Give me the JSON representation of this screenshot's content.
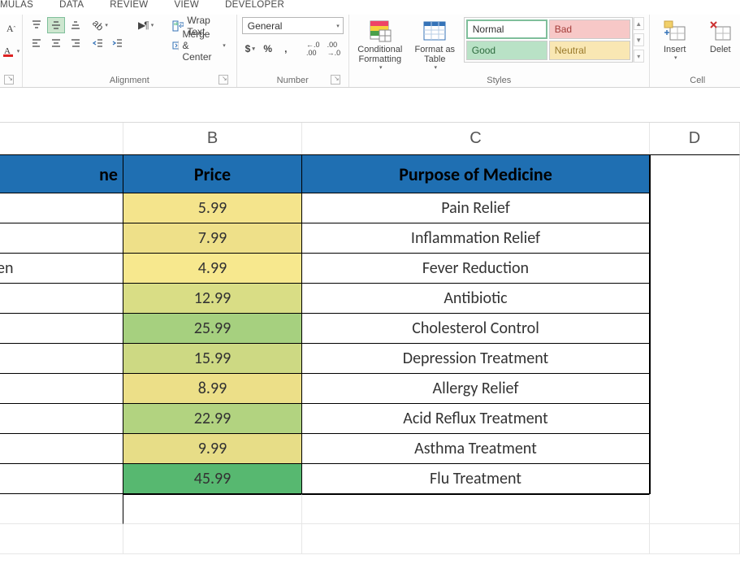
{
  "tabs": {
    "formulas": "MULAS",
    "data": "DATA",
    "review": "REVIEW",
    "view": "VIEW",
    "developer": "DEVELOPER"
  },
  "ribbon": {
    "font": {
      "group_label": ""
    },
    "alignment": {
      "group_label": "Alignment",
      "wrap_label": "Wrap Text",
      "merge_label": "Merge & Center"
    },
    "number": {
      "group_label": "Number",
      "format_selected": "General"
    },
    "styles": {
      "group_label": "Styles",
      "cond_format_label": "Conditional\nFormatting",
      "table_label": "Format as\nTable",
      "normal": "Normal",
      "bad": "Bad",
      "good": "Good",
      "neutral": "Neutral"
    },
    "cells": {
      "group_label": "Cell",
      "insert_label": "Insert",
      "delete_label": "Delet"
    }
  },
  "columns": {
    "B": "B",
    "C": "C",
    "D": "D"
  },
  "table": {
    "headers": {
      "A_fragment": "ne",
      "B": "Price",
      "C": "Purpose of Medicine"
    },
    "rows": [
      {
        "A_fragment": "",
        "price": "5.99",
        "price_bg": "#f4e48c",
        "purpose": "Pain Relief"
      },
      {
        "A_fragment": "",
        "price": "7.99",
        "price_bg": "#eee089",
        "purpose": "Inflammation Relief"
      },
      {
        "A_fragment": "en",
        "price": "4.99",
        "price_bg": "#f7e88e",
        "purpose": "Fever Reduction"
      },
      {
        "A_fragment": "",
        "price": "12.99",
        "price_bg": "#d9dd85",
        "purpose": "Antibiotic"
      },
      {
        "A_fragment": "",
        "price": "25.99",
        "price_bg": "#a6d07f",
        "purpose": "Cholesterol Control"
      },
      {
        "A_fragment": "",
        "price": "15.99",
        "price_bg": "#cdd983",
        "purpose": "Depression Treatment"
      },
      {
        "A_fragment": "",
        "price": "8.99",
        "price_bg": "#ecdf88",
        "purpose": "Allergy Relief"
      },
      {
        "A_fragment": "",
        "price": "22.99",
        "price_bg": "#b2d380",
        "purpose": "Acid Reflux Treatment"
      },
      {
        "A_fragment": "",
        "price": "9.99",
        "price_bg": "#e7dd87",
        "purpose": "Asthma Treatment"
      },
      {
        "A_fragment": "",
        "price": "45.99",
        "price_bg": "#57b870",
        "purpose": "Flu Treatment"
      }
    ]
  }
}
